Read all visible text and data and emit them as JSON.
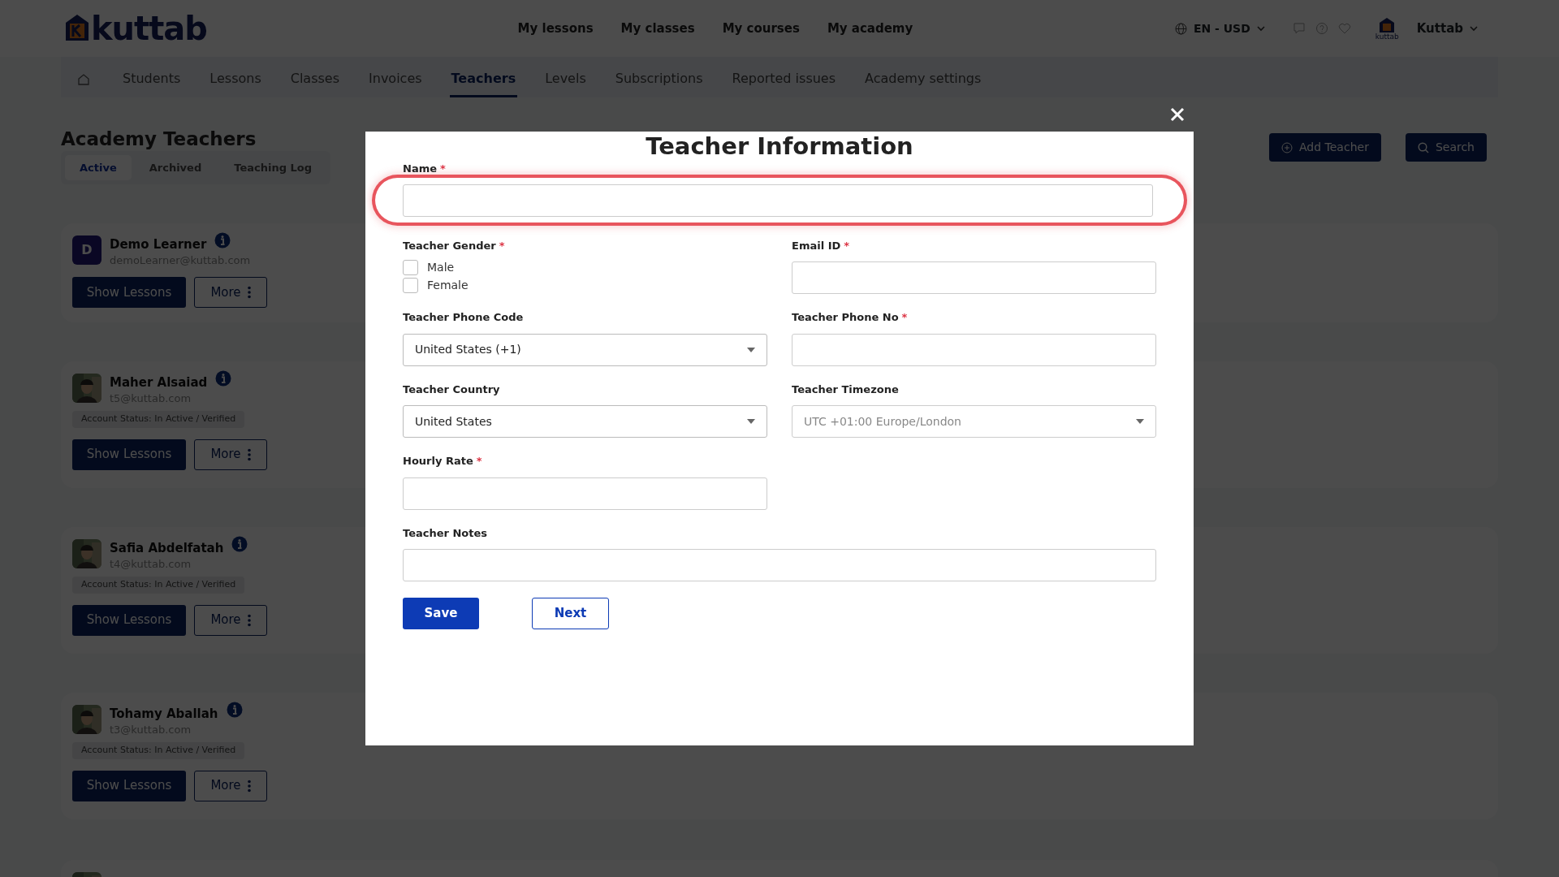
{
  "header": {
    "logo": "kuttab",
    "nav": [
      "My lessons",
      "My classes",
      "My courses",
      "My academy"
    ],
    "locale": "EN - USD",
    "user": {
      "caption": "kuttab",
      "name": "Kuttab"
    }
  },
  "subnav": [
    {
      "kind": "home",
      "selected": false
    },
    {
      "label": "Students",
      "selected": false
    },
    {
      "label": "Lessons",
      "selected": false
    },
    {
      "label": "Classes",
      "selected": false
    },
    {
      "label": "Invoices",
      "selected": false
    },
    {
      "label": "Teachers",
      "selected": true
    },
    {
      "label": "Levels",
      "selected": false
    },
    {
      "label": "Subscriptions",
      "selected": false
    },
    {
      "label": "Reported issues",
      "selected": false
    },
    {
      "label": "Academy settings",
      "selected": false
    }
  ],
  "page": {
    "title": "Academy Teachers",
    "tabs": [
      {
        "label": "Active",
        "selected": true
      },
      {
        "label": "Archived",
        "selected": false
      },
      {
        "label": "Teaching Log",
        "selected": false
      }
    ],
    "buttons": [
      {
        "kind": "add",
        "label": "Add Teacher"
      },
      {
        "kind": "search",
        "label": "Search"
      }
    ]
  },
  "teachers": [
    {
      "name": "Demo Learner",
      "email": "demoLearner@kuttab.com",
      "avatar": {
        "kind": "initial",
        "text": "D"
      },
      "buttons": [
        "Show Lessons",
        "More"
      ]
    },
    {
      "name": "Maher Alsaiad",
      "email": "t5@kuttab.com",
      "avatar": {
        "kind": "picture"
      },
      "status": "Account Status: In Active / Verified",
      "buttons": [
        "Show Lessons",
        "More"
      ]
    },
    {
      "name": "Safia Abdelfatah",
      "email": "t4@kuttab.com",
      "avatar": {
        "kind": "picture"
      },
      "status": "Account Status: In Active / Verified",
      "buttons": [
        "Show Lessons",
        "More"
      ]
    },
    {
      "name": "Tohamy Aballah",
      "email": "t3@kuttab.com",
      "avatar": {
        "kind": "picture"
      },
      "status": "Account Status: In Active / Verified",
      "buttons": [
        "Show Lessons",
        "More"
      ]
    }
  ],
  "modal": {
    "title": "Teacher Information",
    "fields": [
      {
        "kind": "text",
        "label": "Name",
        "mark": "*",
        "wide": true,
        "invalid": true
      },
      {
        "kind": "checkboxes",
        "label": "Teacher Gender",
        "mark": "*",
        "options": [
          {
            "label": "Male",
            "checked": false
          },
          {
            "label": "Female",
            "checked": false
          }
        ]
      },
      {
        "kind": "text",
        "label": "Email ID",
        "mark": "*"
      },
      {
        "kind": "select",
        "label": "Teacher Phone Code",
        "value": "United States (+1)"
      },
      {
        "kind": "text",
        "label": "Teacher Phone No",
        "mark": "*"
      },
      {
        "kind": "select",
        "label": "Teacher Country",
        "value": "United States"
      },
      {
        "kind": "select",
        "label": "Teacher Timezone",
        "value": "UTC +01:00 Europe/London",
        "disabled": true
      },
      {
        "kind": "text",
        "label": "Hourly Rate",
        "mark": "*"
      },
      {
        "kind": "text",
        "label": "Teacher Notes",
        "wide": true
      }
    ],
    "buttons": [
      {
        "kind": "primary",
        "label": "Save"
      },
      {
        "kind": "outline",
        "label": "Next"
      }
    ]
  }
}
